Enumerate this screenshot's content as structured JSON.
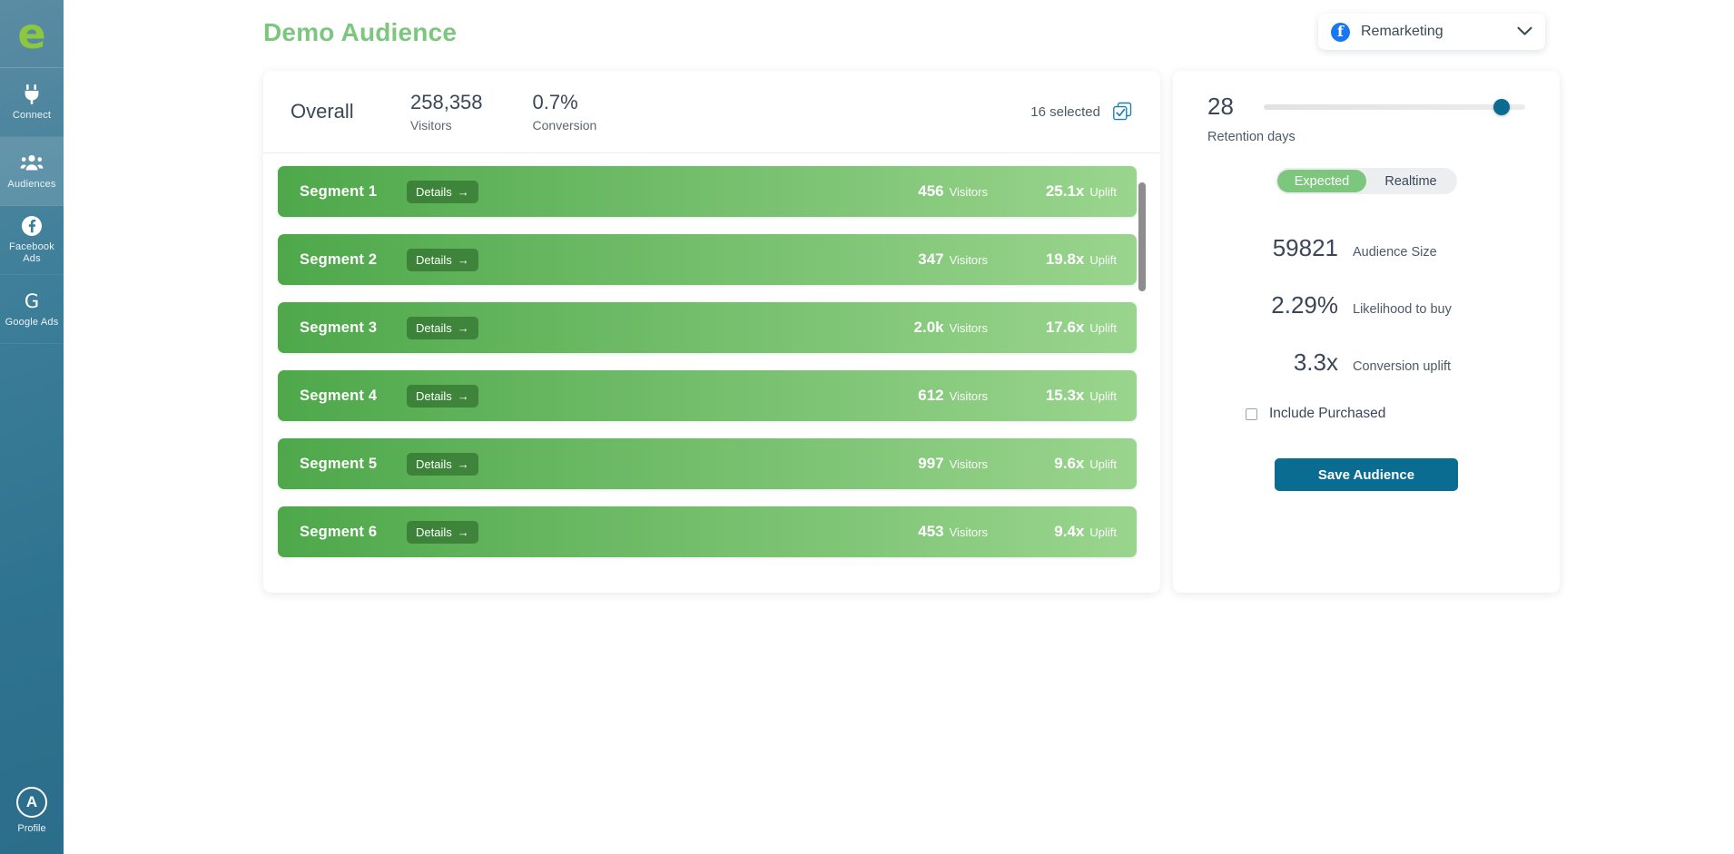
{
  "sidebar": {
    "logo_letter": "e",
    "items": [
      {
        "label": "Connect",
        "icon": "plug-icon",
        "active": false
      },
      {
        "label": "Audiences",
        "icon": "people-icon",
        "active": true
      },
      {
        "label": "Facebook Ads",
        "icon": "facebook-icon",
        "active": false
      },
      {
        "label": "Google Ads",
        "icon": "google-icon",
        "active": false
      }
    ],
    "profile": {
      "label": "Profile",
      "initial": "A"
    }
  },
  "header": {
    "title": "Demo Audience",
    "platform_selector": {
      "label": "Remarketing",
      "icon": "facebook-icon",
      "chevron": "chevron-down-icon"
    }
  },
  "overall": {
    "title": "Overall",
    "stats": [
      {
        "value": "258,358",
        "label": "Visitors"
      },
      {
        "value": "0.7%",
        "label": "Conversion"
      }
    ],
    "selected_text": "16 selected",
    "select_icon": "check-squares-icon"
  },
  "segments": {
    "details_label": "Details",
    "details_arrow": "→",
    "visitors_unit": "Visitors",
    "uplift_unit": "Uplift",
    "rows": [
      {
        "name": "Segment 1",
        "visitors": "456",
        "uplift": "25.1x"
      },
      {
        "name": "Segment 2",
        "visitors": "347",
        "uplift": "19.8x"
      },
      {
        "name": "Segment 3",
        "visitors": "2.0k",
        "uplift": "17.6x"
      },
      {
        "name": "Segment 4",
        "visitors": "612",
        "uplift": "15.3x"
      },
      {
        "name": "Segment 5",
        "visitors": "997",
        "uplift": "9.6x"
      },
      {
        "name": "Segment 6",
        "visitors": "453",
        "uplift": "9.4x"
      }
    ]
  },
  "panel": {
    "retention_value": "28",
    "retention_label": "Retention days",
    "toggle": {
      "options": [
        "Expected",
        "Realtime"
      ],
      "selected": "Expected"
    },
    "metrics": [
      {
        "value": "59821",
        "label": "Audience Size"
      },
      {
        "value": "2.29%",
        "label": "Likelihood to buy"
      },
      {
        "value": "3.3x",
        "label": "Conversion uplift"
      }
    ],
    "checkbox": {
      "label": "Include Purchased",
      "checked": false
    },
    "save_label": "Save Audience"
  },
  "colors": {
    "brand_green": "#7dc67e",
    "segment_start": "#4ea84a",
    "segment_end": "#9ad58e",
    "accent_blue": "#0b6c91",
    "sidebar_top": "#5b8ca3",
    "sidebar_bottom": "#2b6d8a",
    "facebook_blue": "#1877f2",
    "text_dark": "#3b4758"
  }
}
